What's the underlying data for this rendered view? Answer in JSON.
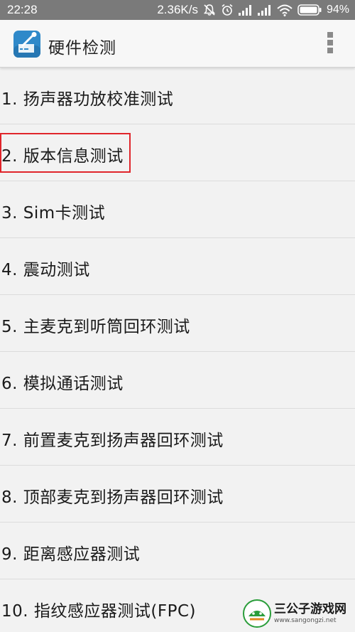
{
  "status_bar": {
    "time": "22:28",
    "network_speed": "2.36K/s",
    "battery_percent": "94%"
  },
  "app_bar": {
    "title": "硬件检测"
  },
  "list": {
    "items": [
      {
        "label": "1. 扬声器功放校准测试"
      },
      {
        "label": "2. 版本信息测试"
      },
      {
        "label": "3. Sim卡测试"
      },
      {
        "label": "4. 震动测试"
      },
      {
        "label": "5. 主麦克到听筒回环测试"
      },
      {
        "label": "6. 模拟通话测试"
      },
      {
        "label": "7. 前置麦克到扬声器回环测试"
      },
      {
        "label": "8. 顶部麦克到扬声器回环测试"
      },
      {
        "label": "9. 距离感应器测试"
      },
      {
        "label": "10. 指纹感应器测试(FPC)"
      }
    ]
  },
  "watermark": {
    "name": "三公子游戏网",
    "url": "www.sangongzi.net"
  },
  "colors": {
    "status_bar_bg": "#7a7a7a",
    "app_bar_bg": "#f7f7f7",
    "list_bg": "#f2f2f2",
    "divider": "#dcdcdc",
    "highlight": "#e0252b",
    "app_icon": "#2f89c9"
  },
  "icons": {
    "app_icon": "hardware-test-app-icon",
    "overflow": "overflow-menu-icon",
    "mute": "mute-icon",
    "alarm": "alarm-icon",
    "signal": "signal-icon",
    "wifi": "wifi-icon",
    "battery": "battery-icon"
  }
}
